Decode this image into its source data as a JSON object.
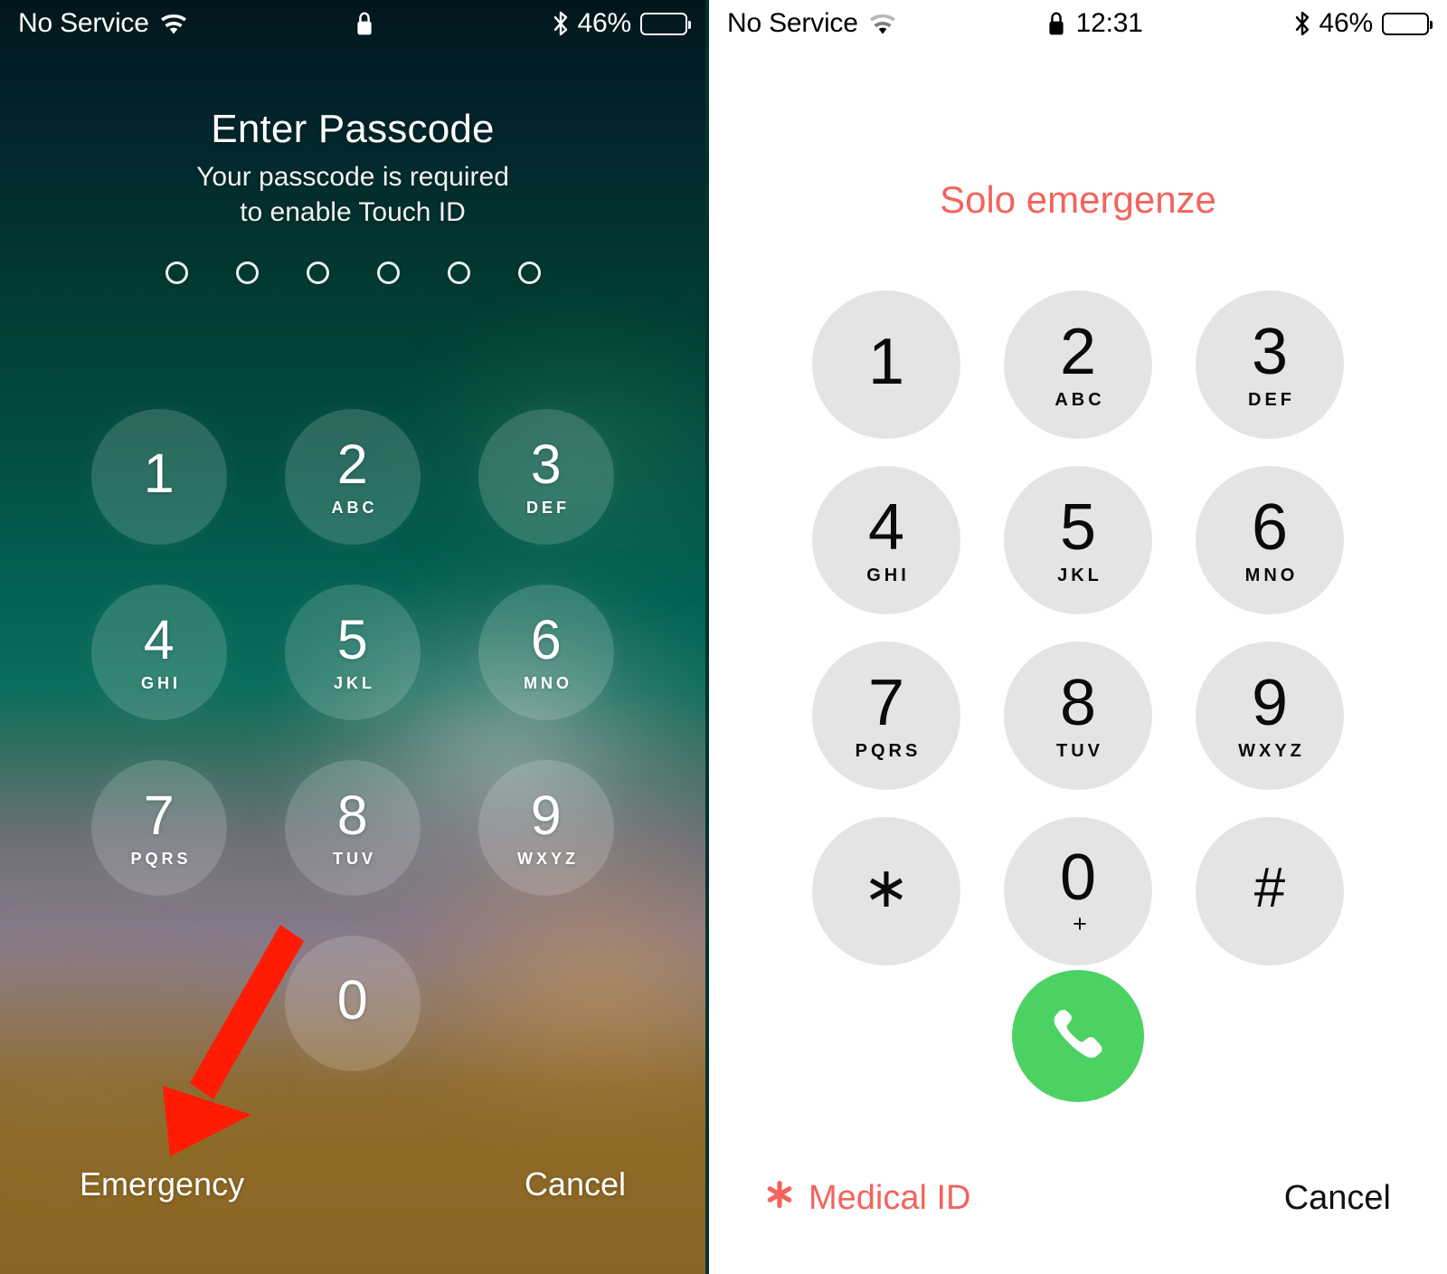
{
  "left_panel": {
    "status_bar": {
      "carrier": "No Service",
      "wifi_icon": "wifi-icon",
      "lock_icon": "lock-icon",
      "time": "",
      "bluetooth_icon": "bluetooth-icon",
      "battery_percent": "46%",
      "battery_level": 46
    },
    "title": "Enter Passcode",
    "subtitle_line1": "Your passcode is required",
    "subtitle_line2": "to enable Touch ID",
    "passcode_dots": 6,
    "passcode_filled": 0,
    "keypad": [
      {
        "num": "1",
        "alpha": ""
      },
      {
        "num": "2",
        "alpha": "ABC"
      },
      {
        "num": "3",
        "alpha": "DEF"
      },
      {
        "num": "4",
        "alpha": "GHI"
      },
      {
        "num": "5",
        "alpha": "JKL"
      },
      {
        "num": "6",
        "alpha": "MNO"
      },
      {
        "num": "7",
        "alpha": "PQRS"
      },
      {
        "num": "8",
        "alpha": "TUV"
      },
      {
        "num": "9",
        "alpha": "WXYZ"
      },
      {
        "num": "",
        "alpha": ""
      },
      {
        "num": "0",
        "alpha": ""
      },
      {
        "num": "",
        "alpha": ""
      }
    ],
    "emergency_label": "Emergency",
    "cancel_label": "Cancel",
    "annotation_arrow_color": "#FF1B04"
  },
  "right_panel": {
    "status_bar": {
      "carrier": "No Service",
      "wifi_icon": "wifi-icon",
      "lock_icon": "lock-icon",
      "time": "12:31",
      "bluetooth_icon": "bluetooth-icon",
      "battery_percent": "46%",
      "battery_level": 46
    },
    "title": "Solo emergenze",
    "keypad": [
      {
        "num": "1",
        "alpha": ""
      },
      {
        "num": "2",
        "alpha": "ABC"
      },
      {
        "num": "3",
        "alpha": "DEF"
      },
      {
        "num": "4",
        "alpha": "GHI"
      },
      {
        "num": "5",
        "alpha": "JKL"
      },
      {
        "num": "6",
        "alpha": "MNO"
      },
      {
        "num": "7",
        "alpha": "PQRS"
      },
      {
        "num": "8",
        "alpha": "TUV"
      },
      {
        "num": "9",
        "alpha": "WXYZ"
      },
      {
        "num": "∗",
        "alpha": ""
      },
      {
        "num": "0",
        "alpha": "+"
      },
      {
        "num": "#",
        "alpha": ""
      }
    ],
    "call_button_icon": "phone-handset-icon",
    "call_button_color": "#4CD263",
    "medical_id_label": "Medical ID",
    "medical_id_icon": "medical-asterisk-icon",
    "cancel_label": "Cancel",
    "title_color": "#F4635C",
    "annotation_arrow_color": "#F03A20"
  }
}
